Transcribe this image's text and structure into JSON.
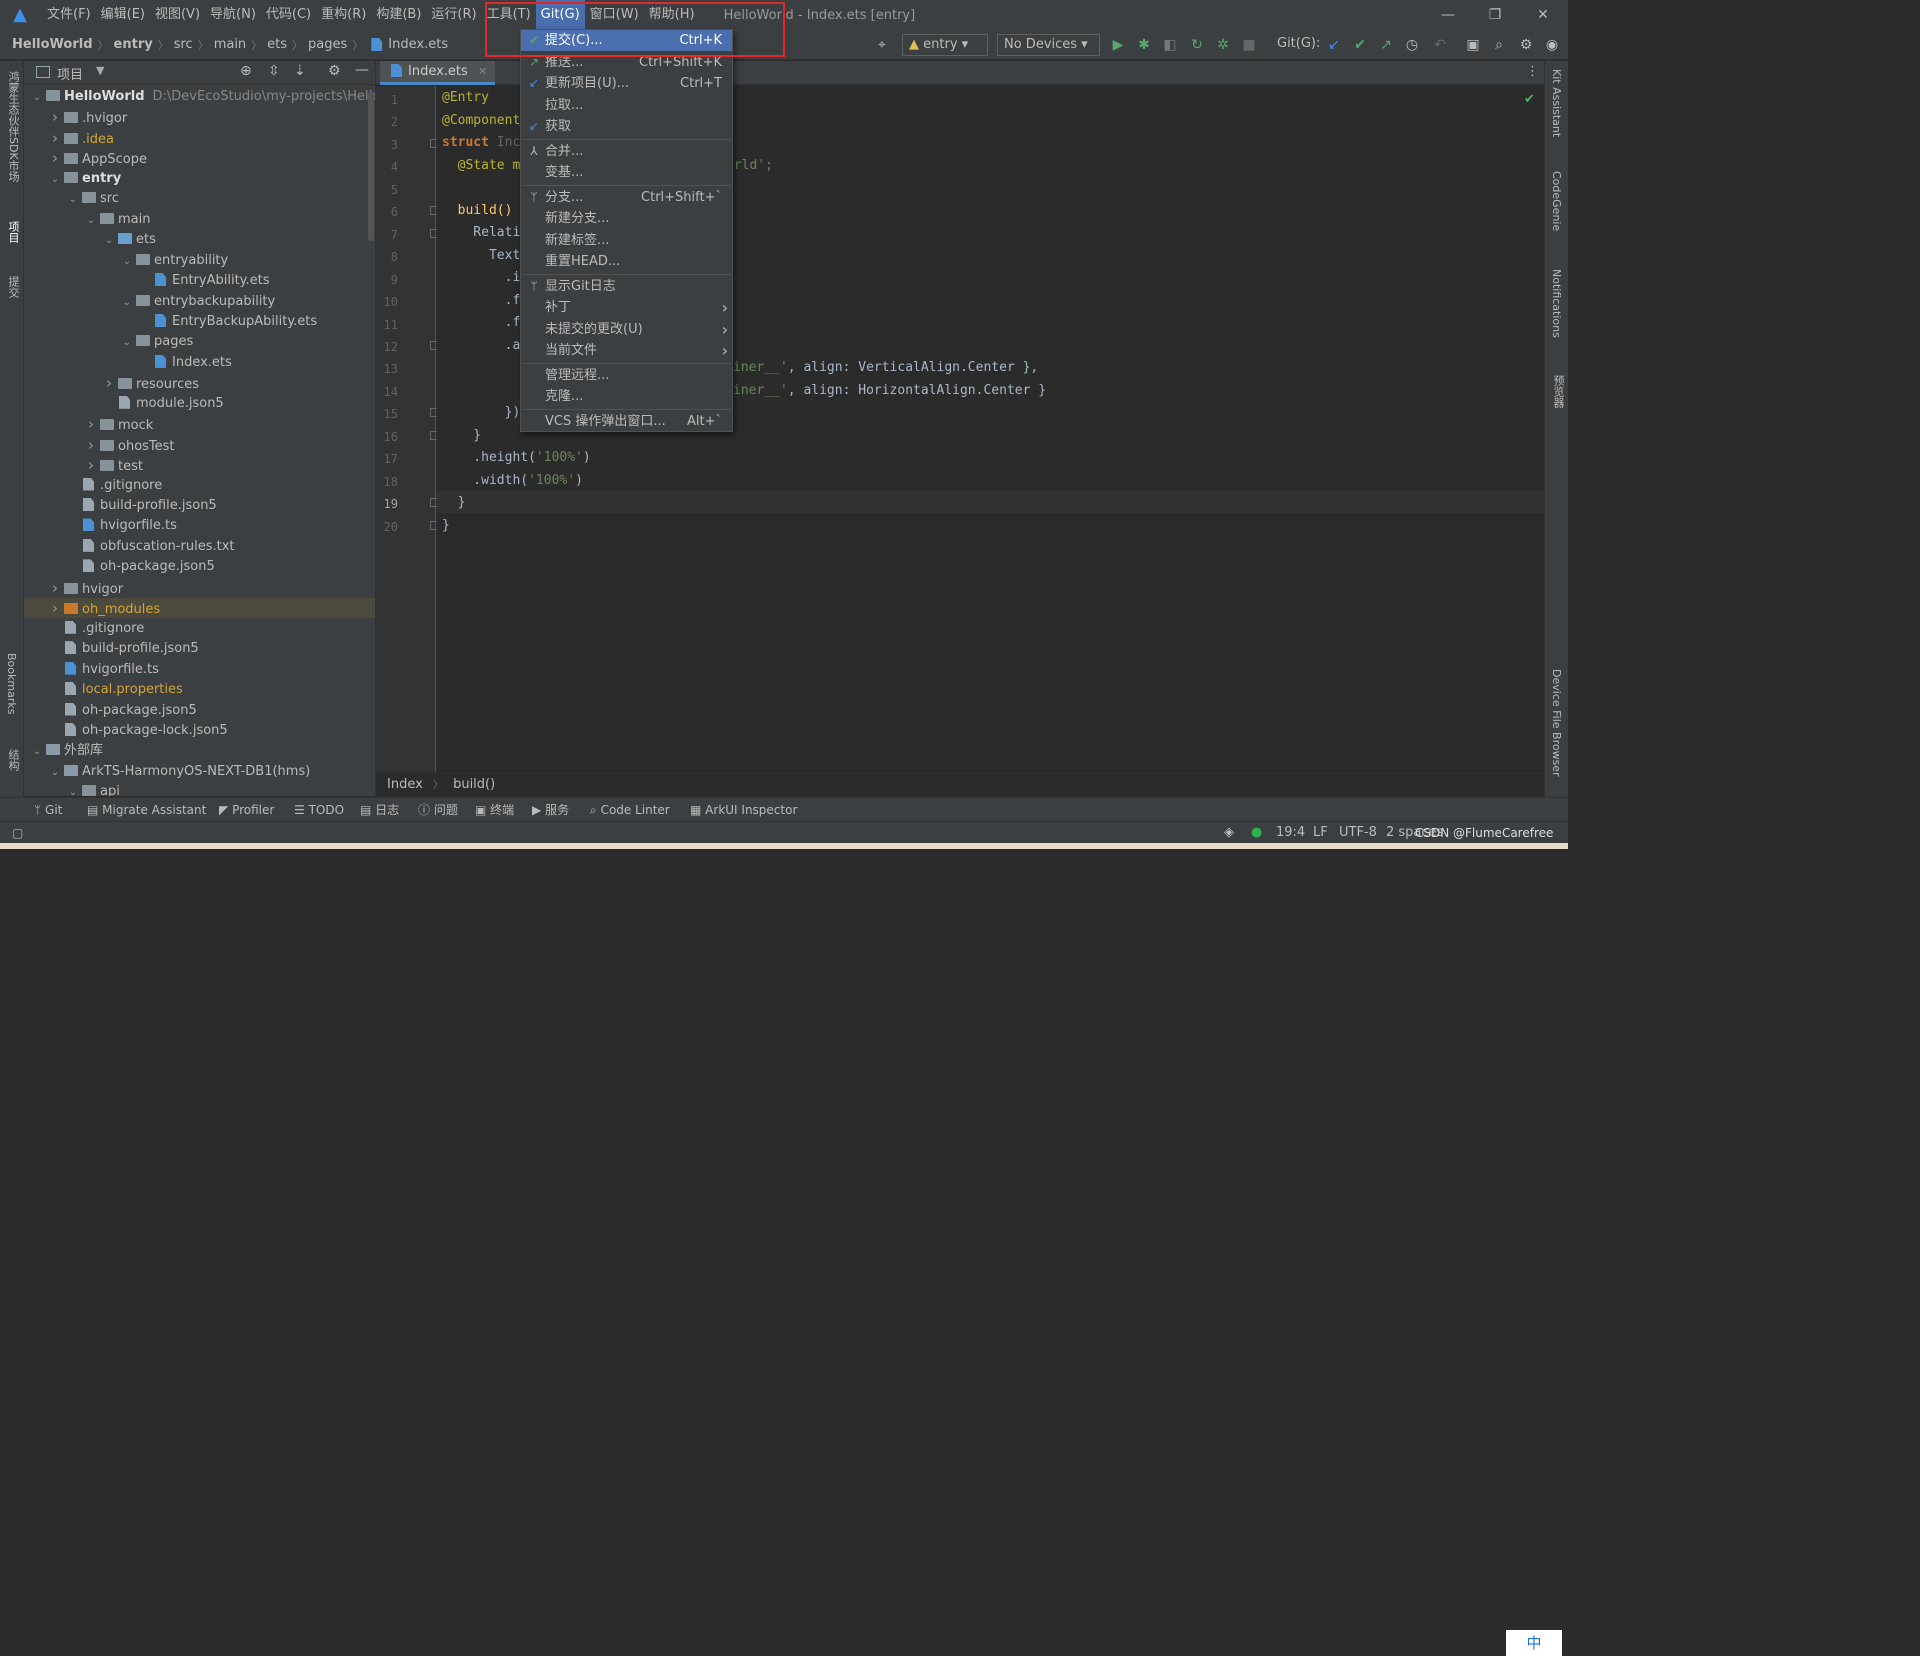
{
  "app": {
    "window_title": "HelloWorld - Index.ets [entry]"
  },
  "menubar": [
    "文件(F)",
    "编辑(E)",
    "视图(V)",
    "导航(N)",
    "代码(C)",
    "重构(R)",
    "构建(B)",
    "运行(R)",
    "工具(T)",
    "Git(G)",
    "窗口(W)",
    "帮助(H)"
  ],
  "breadcrumb": [
    "HelloWorld",
    "entry",
    "src",
    "main",
    "ets",
    "pages",
    "Index.ets"
  ],
  "toolbar": {
    "run_config": "entry",
    "device": "No Devices",
    "git_label": "Git(G):"
  },
  "left_stripe": {
    "sdk": "鸿蒙生态伙伴SDK市场",
    "project": "项目",
    "commit": "提交",
    "bookmarks": "Bookmarks",
    "structure": "结构"
  },
  "project_panel": {
    "title": "项目",
    "tree": [
      {
        "label": "HelloWorld",
        "path": "D:\\DevEcoStudio\\my-projects\\HelloWo"
      },
      {
        "label": ".hvigor"
      },
      {
        "label": ".idea"
      },
      {
        "label": "AppScope"
      },
      {
        "label": "entry"
      },
      {
        "label": "src"
      },
      {
        "label": "main"
      },
      {
        "label": "ets"
      },
      {
        "label": "entryability"
      },
      {
        "label": "EntryAbility.ets"
      },
      {
        "label": "entrybackupability"
      },
      {
        "label": "EntryBackupAbility.ets"
      },
      {
        "label": "pages"
      },
      {
        "label": "Index.ets"
      },
      {
        "label": "resources"
      },
      {
        "label": "module.json5"
      },
      {
        "label": "mock"
      },
      {
        "label": "ohosTest"
      },
      {
        "label": "test"
      },
      {
        "label": ".gitignore"
      },
      {
        "label": "build-profile.json5"
      },
      {
        "label": "hvigorfile.ts"
      },
      {
        "label": "obfuscation-rules.txt"
      },
      {
        "label": "oh-package.json5"
      },
      {
        "label": "hvigor"
      },
      {
        "label": "oh_modules"
      },
      {
        "label": ".gitignore"
      },
      {
        "label": "build-profile.json5"
      },
      {
        "label": "hvigorfile.ts"
      },
      {
        "label": "local.properties"
      },
      {
        "label": "oh-package.json5"
      },
      {
        "label": "oh-package-lock.json5"
      },
      {
        "label": "外部库"
      },
      {
        "label": "ArkTS-HarmonyOS-NEXT-DB1(hms)"
      },
      {
        "label": "api"
      }
    ]
  },
  "editor": {
    "tab": "Index.ets",
    "line_numbers": [
      "1",
      "2",
      "3",
      "4",
      "5",
      "6",
      "7",
      "8",
      "9",
      "10",
      "11",
      "12",
      "13",
      "14",
      "15",
      "16",
      "17",
      "18",
      "19",
      "20"
    ],
    "lines": {
      "l1": "@Entry",
      "l2": "@Component",
      "l3a": "struct ",
      "l3b": "Inc",
      "l4a": "  @State m",
      "l4b": "orld';",
      "l6": "  build()",
      "l7": "    Relati",
      "l8": "      Text",
      "l9": "        .i",
      "l10": "        .f",
      "l11": "        .f",
      "l12": "        .a",
      "l13a": "iner__'",
      ", ": "",
      "l13b": ", align: VerticalAlign.Center },",
      "l14a": "iner__'",
      "l14b": ", align: HorizontalAlign.Center }",
      "l15": "        })",
      "l16": "    }",
      "l17a": "    .height(",
      "l17b": "'100%'",
      "l17c": ")",
      "l18a": "    .width(",
      "l18b": "'100%'",
      "l18c": ")",
      "l19": "  }",
      "l20": "}"
    },
    "bottom_crumb": [
      "Index",
      "build()"
    ]
  },
  "right_stripe": {
    "kit": "Kit Assistant",
    "codegenie": "CodeGenie",
    "notifications": "Notifications",
    "preview": "预览器",
    "device_files": "Device File Browser"
  },
  "bottom_tools": [
    "Git",
    "Migrate Assistant",
    "Profiler",
    "TODO",
    "日志",
    "问题",
    "终端",
    "服务",
    "Code Linter",
    "ArkUI Inspector"
  ],
  "status": {
    "position": "19:4",
    "line_sep": "LF",
    "encoding": "UTF-8",
    "indent": "2 spaces",
    "ime": "中",
    "watermark": "CSDN @FlumeCarefree"
  },
  "git_menu": [
    {
      "label": "提交(C)...",
      "shortcut": "Ctrl+K"
    },
    {
      "label": "推送...",
      "shortcut": "Ctrl+Shift+K"
    },
    {
      "label": "更新项目(U)...",
      "shortcut": "Ctrl+T"
    },
    {
      "label": "拉取...",
      "shortcut": ""
    },
    {
      "label": "获取",
      "shortcut": ""
    },
    {
      "label": "合并...",
      "shortcut": ""
    },
    {
      "label": "变基...",
      "shortcut": ""
    },
    {
      "label": "分支...",
      "shortcut": "Ctrl+Shift+`"
    },
    {
      "label": "新建分支...",
      "shortcut": ""
    },
    {
      "label": "新建标签...",
      "shortcut": ""
    },
    {
      "label": "重置HEAD...",
      "shortcut": ""
    },
    {
      "label": "显示Git日志",
      "shortcut": ""
    },
    {
      "label": "补丁",
      "shortcut": ""
    },
    {
      "label": "未提交的更改(U)",
      "shortcut": ""
    },
    {
      "label": "当前文件",
      "shortcut": ""
    },
    {
      "label": "管理远程...",
      "shortcut": ""
    },
    {
      "label": "克隆...",
      "shortcut": ""
    },
    {
      "label": "VCS 操作弹出窗口...",
      "shortcut": "Alt+`"
    }
  ],
  "colors": {
    "menu_highlight": "#4b6eaf",
    "annotation_box": "#e02a2a",
    "run_green": "#59a869",
    "keyword": "#cc7832",
    "string": "#6a8759"
  }
}
